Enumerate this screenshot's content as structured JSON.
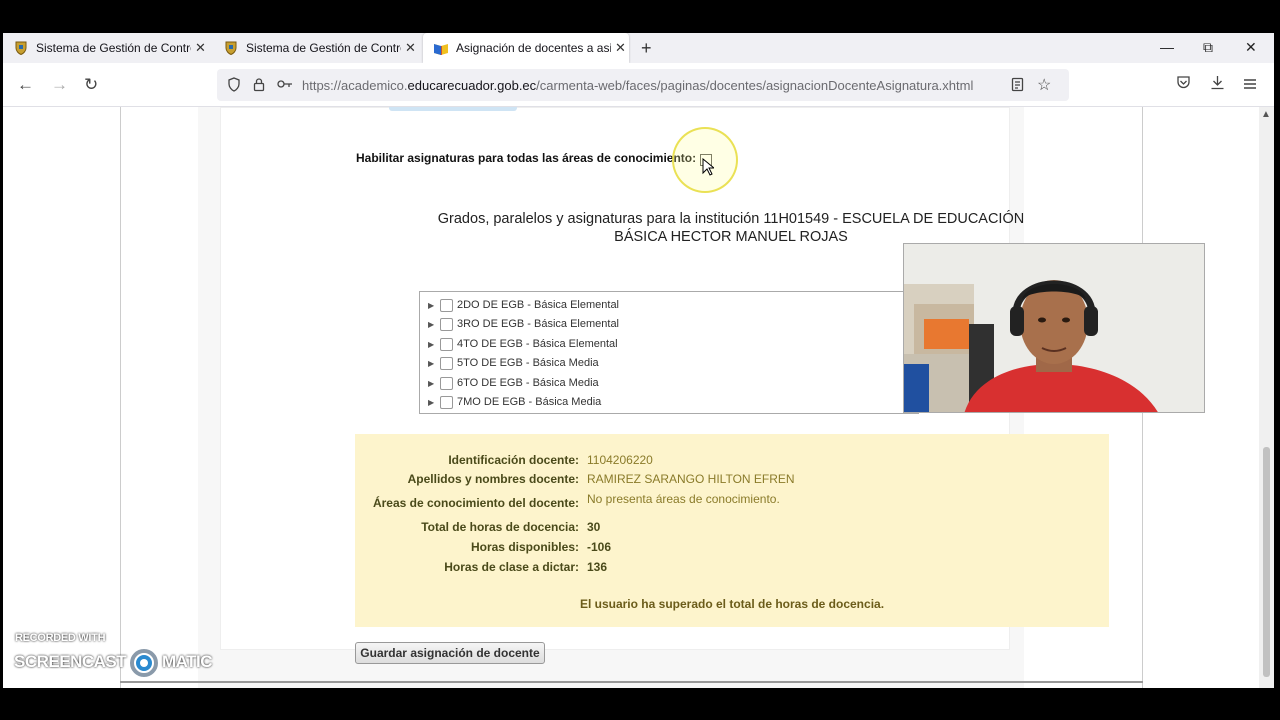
{
  "browser": {
    "tabs": [
      {
        "title": "Sistema de Gestión de Control E",
        "close": "✕"
      },
      {
        "title": "Sistema de Gestión de Control E",
        "close": "✕"
      },
      {
        "title": "Asignación de docentes a asign",
        "close": "✕"
      }
    ],
    "new_tab": "+",
    "window": {
      "minimize": "—",
      "restore": "⧉",
      "close": "✕"
    },
    "url_prefix": "https://academico.",
    "url_domain": "educarecuador.gob.ec",
    "url_path": "/carmenta-web/faces/paginas/docentes/asignacionDocenteAsignatura.xhtml"
  },
  "page": {
    "enable_label": "Habilitar asignaturas para todas las áreas de conocimiento:",
    "grades_title_line1": "Grados, paralelos y asignaturas para la institución 11H01549 - ESCUELA DE EDUCACIÓN",
    "grades_title_line2": "BÁSICA HECTOR MANUEL ROJAS",
    "tree_items": [
      "2DO DE EGB - Básica Elemental",
      "3RO DE EGB - Básica Elemental",
      "4TO DE EGB - Básica Elemental",
      "5TO DE EGB - Básica Media",
      "6TO DE EGB - Básica Media",
      "7MO DE EGB - Básica Media"
    ],
    "info": {
      "id_label": "Identificación docente:",
      "id_value": "1104206220",
      "name_label": "Apellidos y nombres docente:",
      "name_value": "RAMIREZ SARANGO HILTON EFREN",
      "areas_label": "Áreas de conocimiento del docente:",
      "areas_value": "No presenta áreas de conocimiento.",
      "total_label": "Total de horas de docencia:",
      "total_value": "30",
      "avail_label": "Horas disponibles:",
      "avail_value": "-106",
      "class_label": "Horas de clase a dictar:",
      "class_value": "136",
      "warning": "El usuario ha superado el total de horas de docencia."
    },
    "save_button": "Guardar asignación de docente"
  },
  "watermark": {
    "line1": "RECORDED WITH",
    "left": "SCREENCAST",
    "right": "MATIC"
  },
  "colors": {
    "info_bg": "#fdf4cc",
    "highlight": "#f0e040"
  }
}
